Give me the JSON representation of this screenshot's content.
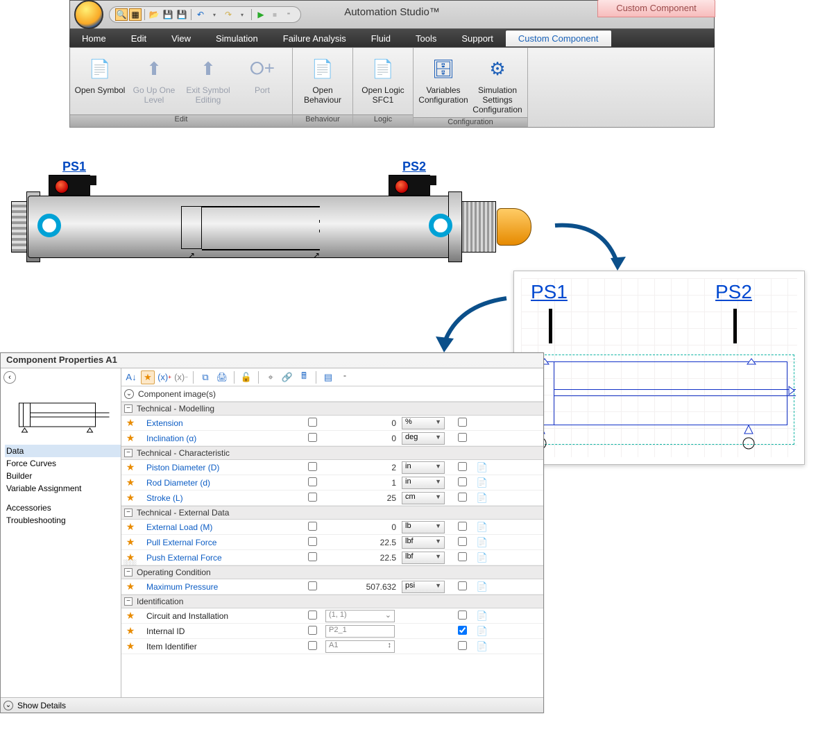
{
  "app": {
    "title": "Automation Studio™",
    "contextTab": "Custom Component"
  },
  "menus": [
    "Home",
    "Edit",
    "View",
    "Simulation",
    "Failure Analysis",
    "Fluid",
    "Tools",
    "Support",
    "Custom Component"
  ],
  "activeMenu": "Custom Component",
  "ribbonGroups": [
    {
      "label": "Edit",
      "buttons": [
        {
          "name": "open-symbol",
          "label": "Open Symbol",
          "disabled": false
        },
        {
          "name": "go-up",
          "label": "Go Up One Level",
          "disabled": true
        },
        {
          "name": "exit-symbol",
          "label": "Exit Symbol Editing",
          "disabled": true
        },
        {
          "name": "port",
          "label": "Port",
          "disabled": true
        }
      ]
    },
    {
      "label": "Behaviour",
      "buttons": [
        {
          "name": "open-behaviour",
          "label": "Open Behaviour",
          "disabled": false
        }
      ]
    },
    {
      "label": "Logic",
      "buttons": [
        {
          "name": "open-logic",
          "label": "Open Logic SFC1",
          "disabled": false
        }
      ]
    },
    {
      "label": "Configuration",
      "buttons": [
        {
          "name": "vars-config",
          "label": "Variables Configuration",
          "disabled": false
        },
        {
          "name": "sim-settings",
          "label": "Simulation Settings Configuration",
          "disabled": false
        }
      ]
    }
  ],
  "cylinder": {
    "sensor1": "PS1",
    "sensor2": "PS2"
  },
  "symbol": {
    "label1": "PS1",
    "label2": "PS2"
  },
  "props": {
    "title": "Component Properties A1",
    "nav": [
      "Data",
      "Force Curves",
      "Builder",
      "Variable Assignment",
      "",
      "Accessories",
      "Troubleshooting"
    ],
    "navSelected": "Data",
    "expander": "Component image(s)",
    "footer": "Show Details",
    "sections": [
      {
        "title": "Technical - Modelling",
        "rows": [
          {
            "label": "Extension",
            "value": "0",
            "unit": "%",
            "link": true,
            "icon": ""
          },
          {
            "label": "Inclination (α)",
            "value": "0",
            "unit": "deg",
            "link": true,
            "icon": ""
          }
        ]
      },
      {
        "title": "Technical - Characteristic",
        "rows": [
          {
            "label": "Piston Diameter (D)",
            "value": "2",
            "unit": "in",
            "link": true,
            "icon": "📄"
          },
          {
            "label": "Rod Diameter (d)",
            "value": "1",
            "unit": "in",
            "link": true,
            "icon": "📄"
          },
          {
            "label": "Stroke (L)",
            "value": "25",
            "unit": "cm",
            "link": true,
            "icon": "📄"
          }
        ]
      },
      {
        "title": "Technical - External Data",
        "rows": [
          {
            "label": "External Load (M)",
            "value": "0",
            "unit": "lb",
            "link": true,
            "icon": "📄"
          },
          {
            "label": "Pull External Force",
            "value": "22.5",
            "unit": "lbf",
            "link": true,
            "icon": "📄"
          },
          {
            "label": "Push External Force",
            "value": "22.5",
            "unit": "lbf",
            "link": true,
            "icon": "📄"
          }
        ]
      },
      {
        "title": "Operating Condition",
        "rows": [
          {
            "label": "Maximum Pressure",
            "value": "507.632",
            "unit": "psi",
            "link": true,
            "icon": "📄"
          }
        ]
      },
      {
        "title": "Identification",
        "rows": [
          {
            "label": "Circuit and Installation",
            "idbox": "(1, 1)",
            "dd": true,
            "link": false,
            "icon": "📄",
            "chk2": false
          },
          {
            "label": "Internal ID",
            "idbox": "P2_1",
            "link": false,
            "icon": "📄",
            "chk2": true
          },
          {
            "label": "Item Identifier",
            "idbox": "A1",
            "spin": true,
            "link": false,
            "icon": "📄",
            "chk2": false
          }
        ]
      }
    ]
  }
}
